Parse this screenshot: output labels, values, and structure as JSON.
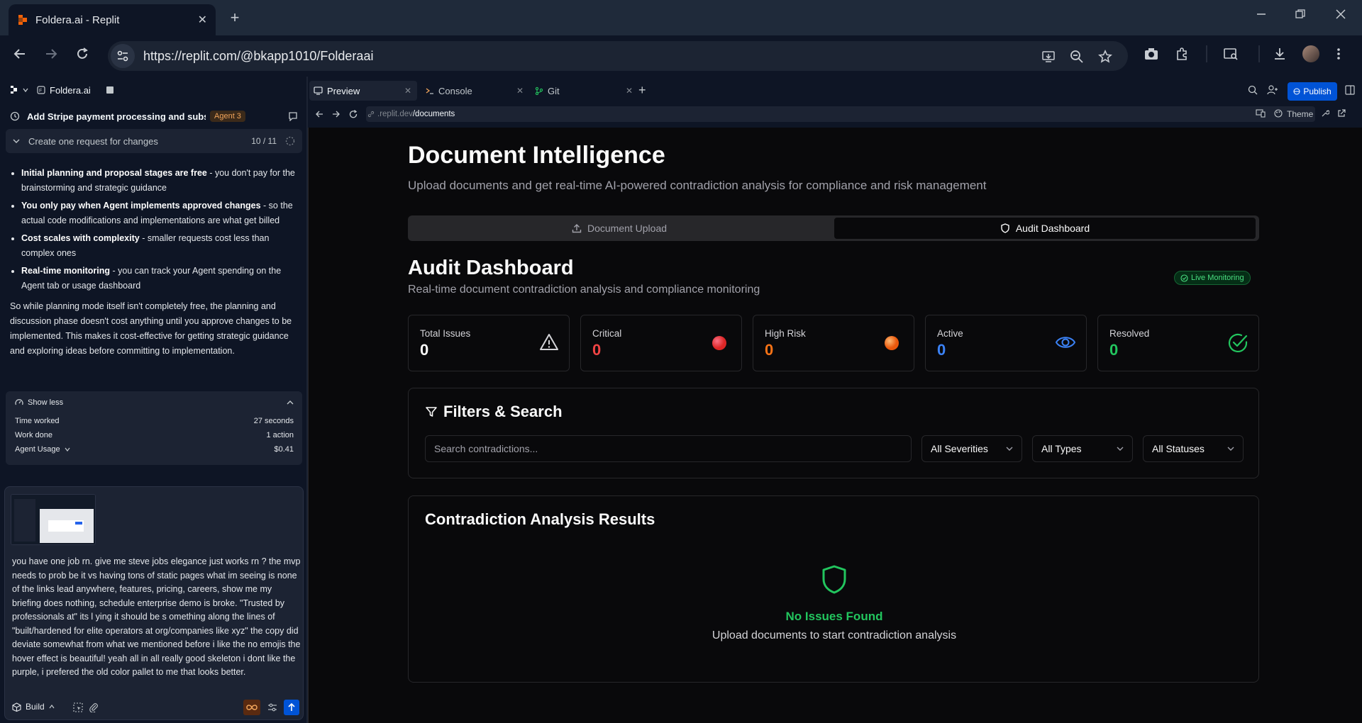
{
  "browser": {
    "tab_title": "Foldera.ai - Replit",
    "url": "https://replit.com/@bkapp1010/Folderaai"
  },
  "left_pane": {
    "project_name": "Foldera.ai",
    "thread_title": "Add Stripe payment processing and subs...",
    "agent_badge": "Agent 3",
    "request_label": "Create one request for changes",
    "request_count": "10 / 11",
    "bullets": [
      {
        "bold": "Initial planning and proposal stages are free",
        "text": " - you don't pay for the brainstorming and strategic guidance"
      },
      {
        "bold": "You only pay when Agent implements approved changes",
        "text": " - so the actual code modifications and implementations are what get billed"
      },
      {
        "bold": "Cost scales with complexity",
        "text": " - smaller requests cost less than complex ones"
      },
      {
        "bold": "Real-time monitoring",
        "text": " - you can track your Agent spending on the Agent tab or usage dashboard"
      }
    ],
    "summary": "So while planning mode itself isn't completely free, the planning and discussion phase doesn't cost anything until you approve changes to be implemented. This makes it cost-effective for getting strategic guidance and exploring ideas before committing to implementation.",
    "usage": {
      "toggle_label": "Show less",
      "rows": [
        {
          "label": "Time worked",
          "value": "27 seconds"
        },
        {
          "label": "Work done",
          "value": "1 action"
        },
        {
          "label": "Agent Usage",
          "value": "$0.41"
        }
      ]
    },
    "composer": {
      "prompt": "you have one job rn. give me steve jobs elegance just works rn ? the mvp needs to prob be it vs having tons of static pages what im seeing is none of the links lead anywhere, features, pricing, careers, show me my briefing does nothing, schedule enterprise demo is broke. \"Trusted by professionals at\" its l ying it should be s omething along the lines of \"built/hardened for elite operators at org/companies like xyz\" the copy did deviate somewhat from what we mentioned before i like the no emojis the hover effect is beautiful! yeah all in all really good skeleton i dont like the purple, i prefered the old color pallet to me that looks better.",
      "mode_label": "Build"
    }
  },
  "right_pane": {
    "tabs": [
      {
        "label": "Preview"
      },
      {
        "label": "Console"
      },
      {
        "label": "Git"
      }
    ],
    "publish_label": "Publish",
    "preview_url_prefix": ".replit.dev",
    "preview_url_path": "/documents",
    "theme_label": "Theme"
  },
  "app": {
    "title": "Document Intelligence",
    "subtitle": "Upload documents and get real-time AI-powered contradiction analysis for compliance and risk management",
    "tab_upload": "Document Upload",
    "tab_audit": "Audit Dashboard",
    "dashboard_title": "Audit Dashboard",
    "dashboard_subtitle": "Real-time document contradiction analysis and compliance monitoring",
    "live_badge": "Live Monitoring",
    "stats": [
      {
        "label": "Total Issues",
        "value": "0",
        "color": "#fafafa"
      },
      {
        "label": "Critical",
        "value": "0",
        "color": "#ef4444"
      },
      {
        "label": "High Risk",
        "value": "0",
        "color": "#f97316"
      },
      {
        "label": "Active",
        "value": "0",
        "color": "#3b82f6"
      },
      {
        "label": "Resolved",
        "value": "0",
        "color": "#22c55e"
      }
    ],
    "filters_title": "Filters & Search",
    "search_placeholder": "Search contradictions...",
    "filter_severity": "All Severities",
    "filter_type": "All Types",
    "filter_status": "All Statuses",
    "results_title": "Contradiction Analysis Results",
    "empty_title": "No Issues Found",
    "empty_subtitle": "Upload documents to start contradiction analysis"
  }
}
